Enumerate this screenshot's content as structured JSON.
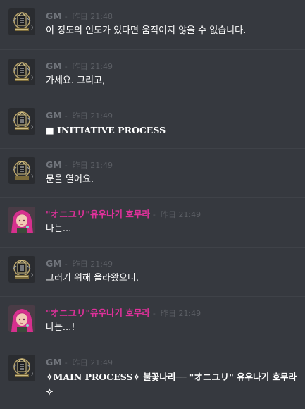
{
  "messages": [
    {
      "author": "GM",
      "sep": "-",
      "time": "昨日 21:48",
      "avatar": "gm-emblem",
      "text": "이 정도의 인도가 있다면 움직이지 않을 수 없습니다."
    },
    {
      "author": "GM",
      "sep": "-",
      "time": "昨日 21:49",
      "avatar": "gm-emblem",
      "text": "가세요. 그리고,"
    },
    {
      "author": "GM",
      "sep": "-",
      "time": "昨日 21:49",
      "avatar": "gm-emblem",
      "text": "■ INITIATIVE PROCESS"
    },
    {
      "author": "GM",
      "sep": "-",
      "time": "昨日 21:49",
      "avatar": "gm-emblem",
      "text": "문을 열어요."
    },
    {
      "author": "\"オニユリ\"유우나기 호무라",
      "sep": "-",
      "time": "昨日 21:49",
      "avatar": "pink-hair-character",
      "text": "나는..."
    },
    {
      "author": "GM",
      "sep": "-",
      "time": "昨日 21:49",
      "avatar": "gm-emblem",
      "text": "그러기 위해 올라왔으니."
    },
    {
      "author": "\"オニユリ\"유우나기 호무라",
      "sep": "-",
      "time": "昨日 21:49",
      "avatar": "pink-hair-character",
      "text": "나는...!"
    },
    {
      "author": "GM",
      "sep": "-",
      "time": "昨日 21:49",
      "avatar": "gm-emblem",
      "text": "✧MAIN PROCESS✧ 불꽃나리── \"オニユリ\" 유우나기 호무라 ✧"
    }
  ],
  "colors": {
    "background": "#36393f",
    "gm_name": "#72767d",
    "player_name": "#e0319b",
    "text": "#ffffff",
    "timestamp": "#5b5e64"
  }
}
